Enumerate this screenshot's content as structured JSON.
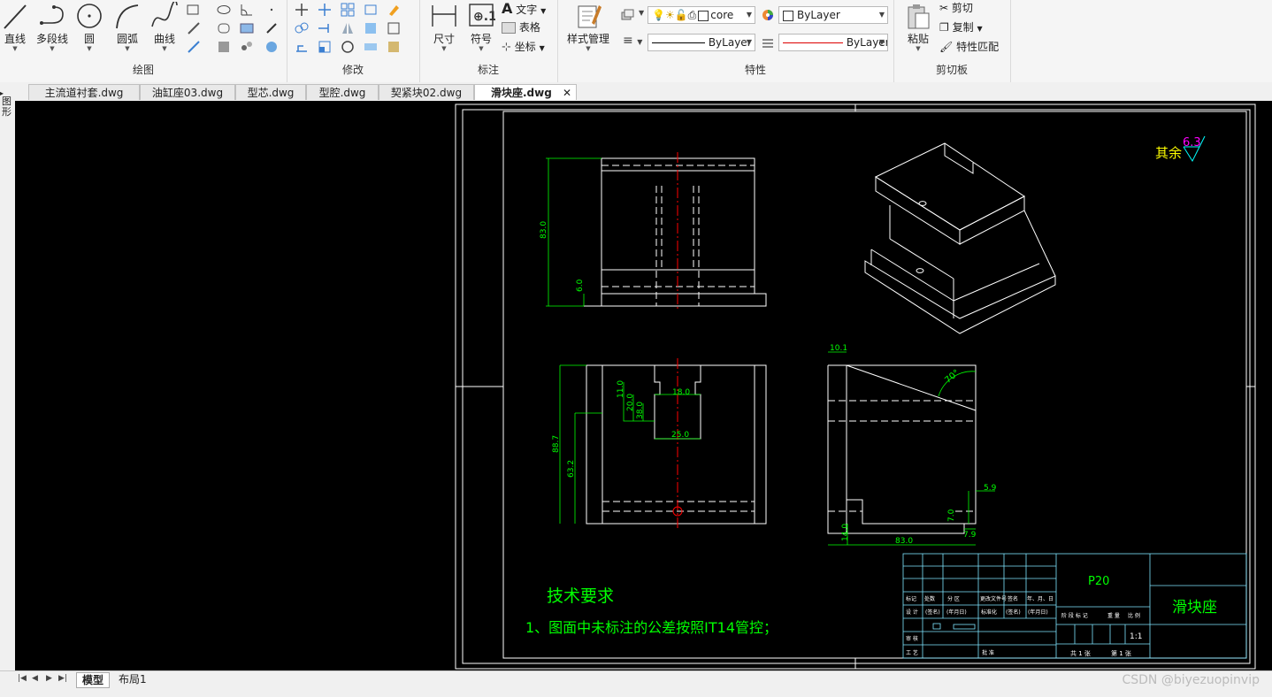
{
  "ribbon": {
    "draw": {
      "title": "绘图",
      "tools": [
        {
          "label": "直线",
          "icon": "line-icon"
        },
        {
          "label": "多段线",
          "icon": "polyline-icon"
        },
        {
          "label": "圆",
          "icon": "circle-icon"
        },
        {
          "label": "圆弧",
          "icon": "arc-icon"
        },
        {
          "label": "曲线",
          "icon": "spline-icon"
        }
      ]
    },
    "modify": {
      "title": "修改"
    },
    "annotate": {
      "title": "标注",
      "dimension_label": "尺寸",
      "symbol_label": "符号",
      "text_label": "文字",
      "table_label": "表格",
      "coordinate_label": "坐标"
    },
    "style": {
      "label": "样式管理"
    },
    "properties": {
      "title": "特性",
      "color_value": "core",
      "layer_color_value": "ByLayer",
      "linetype_value": "ByLayer",
      "lineweight_value": "ByLayer"
    },
    "clipboard": {
      "title": "剪切板",
      "paste_label": "粘贴",
      "cut_label": "剪切",
      "copy_label": "复制",
      "match_label": "特性匹配"
    }
  },
  "tabs": [
    {
      "label": "主流道衬套.dwg",
      "active": false
    },
    {
      "label": "油缸座03.dwg",
      "active": false
    },
    {
      "label": "型芯.dwg",
      "active": false
    },
    {
      "label": "型腔.dwg",
      "active": false
    },
    {
      "label": "契紧块02.dwg",
      "active": false
    },
    {
      "label": "滑块座.dwg",
      "active": true
    }
  ],
  "side_panel_label": "图形",
  "layout_tabs": [
    {
      "label": "模型",
      "active": true
    },
    {
      "label": "布局1",
      "active": false
    }
  ],
  "drawing": {
    "surface_note_prefix": "其余",
    "surface_note_value": "6.3",
    "dims_front": [
      "83.0",
      "6.0"
    ],
    "dims_section": [
      "11.0",
      "20.0",
      "18.0",
      "38.0",
      "25.0",
      "88.7",
      "63.2"
    ],
    "dims_side": [
      "10.1",
      "70°",
      "5.9",
      "7.0",
      "7.9",
      "14.0",
      "83.0"
    ],
    "tech_title": "技术要求",
    "tech_note": "1、图面中未标注的公差按照IT14管控；",
    "title_block": {
      "code": "P20",
      "part_name": "滑块座",
      "scale": "1:1",
      "sheet_left": "共 1 张",
      "sheet_right": "第 1 张",
      "labels_row1": [
        "标记",
        "处数",
        "分 区",
        "更改文件号",
        "签名",
        "年、月、日"
      ],
      "labels_row2": [
        "设 计",
        "(签名)",
        "(年月日)",
        "标准化",
        "(签名)",
        "(年月日)"
      ],
      "labels_row3": [
        "阶 段 标 记",
        "重 量",
        "比 例"
      ],
      "labels_left": [
        "审 核",
        "工 艺",
        "批 准"
      ]
    }
  },
  "watermark": "CSDN @biyezuopinvip",
  "colors": {
    "canvas": "#000000",
    "line": "#ffffff",
    "dim": "#00ff00",
    "center": "#ff0000",
    "titleblock": "#7fe5ff",
    "note": "#ffff00",
    "magenta": "#ff00ff"
  }
}
